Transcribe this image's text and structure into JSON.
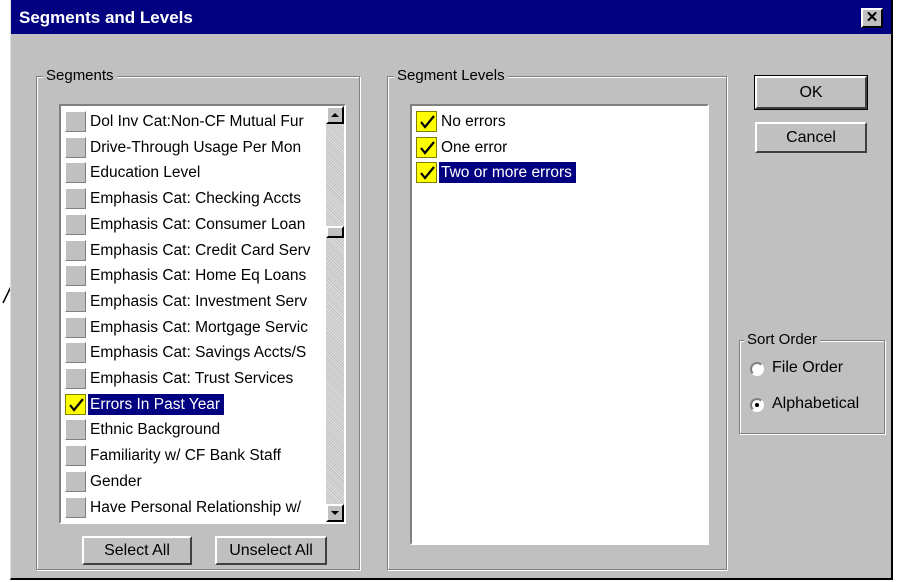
{
  "window": {
    "title": "Segments and Levels",
    "close_symbol": "✕"
  },
  "segments": {
    "legend": "Segments",
    "items": [
      {
        "label": "Dol Inv Cat:Non-CF Mutual Fur",
        "checked": false,
        "selected": false
      },
      {
        "label": "Drive-Through Usage Per Mon",
        "checked": false,
        "selected": false
      },
      {
        "label": "Education Level",
        "checked": false,
        "selected": false
      },
      {
        "label": "Emphasis Cat: Checking Accts",
        "checked": false,
        "selected": false
      },
      {
        "label": "Emphasis Cat: Consumer Loan",
        "checked": false,
        "selected": false
      },
      {
        "label": "Emphasis Cat: Credit Card Serv",
        "checked": false,
        "selected": false
      },
      {
        "label": "Emphasis Cat: Home Eq Loans",
        "checked": false,
        "selected": false
      },
      {
        "label": "Emphasis Cat: Investment Serv",
        "checked": false,
        "selected": false
      },
      {
        "label": "Emphasis Cat: Mortgage Servic",
        "checked": false,
        "selected": false
      },
      {
        "label": "Emphasis Cat: Savings Accts/S",
        "checked": false,
        "selected": false
      },
      {
        "label": "Emphasis Cat: Trust Services",
        "checked": false,
        "selected": false
      },
      {
        "label": "Errors In Past Year",
        "checked": true,
        "selected": true
      },
      {
        "label": "Ethnic Background",
        "checked": false,
        "selected": false
      },
      {
        "label": "Familiarity w/ CF Bank Staff",
        "checked": false,
        "selected": false
      },
      {
        "label": "Gender",
        "checked": false,
        "selected": false
      },
      {
        "label": "Have Personal Relationship w/",
        "checked": false,
        "selected": false
      }
    ],
    "select_all_label": "Select All",
    "unselect_all_label": "Unselect All"
  },
  "segment_levels": {
    "legend": "Segment Levels",
    "items": [
      {
        "label": "No errors",
        "checked": true,
        "selected": false
      },
      {
        "label": "One error",
        "checked": true,
        "selected": false
      },
      {
        "label": "Two or more errors",
        "checked": true,
        "selected": true
      }
    ]
  },
  "actions": {
    "ok_label": "OK",
    "cancel_label": "Cancel"
  },
  "sort_order": {
    "legend": "Sort Order",
    "options": [
      {
        "label": "File Order",
        "selected": false
      },
      {
        "label": "Alphabetical",
        "selected": true
      }
    ]
  },
  "colors": {
    "title_bar": "#000080",
    "face": "#c0c0c0",
    "selection": "#000080",
    "check_fill": "#ffff00"
  }
}
